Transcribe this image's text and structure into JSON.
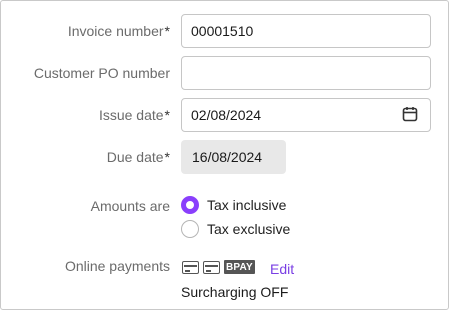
{
  "form": {
    "invoice_number": {
      "label": "Invoice number",
      "required": "*",
      "value": "00001510"
    },
    "customer_po": {
      "label": "Customer PO number",
      "value": ""
    },
    "issue_date": {
      "label": "Issue date",
      "required": "*",
      "value": "02/08/2024",
      "icon": "calendar-icon"
    },
    "due_date": {
      "label": "Due date",
      "required": "*",
      "value": "16/08/2024"
    },
    "amounts": {
      "label": "Amounts are",
      "options": [
        {
          "label": "Tax inclusive",
          "selected": true
        },
        {
          "label": "Tax exclusive",
          "selected": false
        }
      ]
    },
    "online_payments": {
      "label": "Online payments",
      "icons": [
        "credit-card-icon",
        "debit-card-icon",
        "bpay-icon"
      ],
      "bpay_text": "BPAY",
      "edit_label": "Edit",
      "surcharging": "Surcharging OFF"
    }
  },
  "colors": {
    "accent": "#8a3ffc",
    "link": "#7a3fe4",
    "readonly_bg": "#e8e8e8",
    "label": "#6b6b6b"
  }
}
